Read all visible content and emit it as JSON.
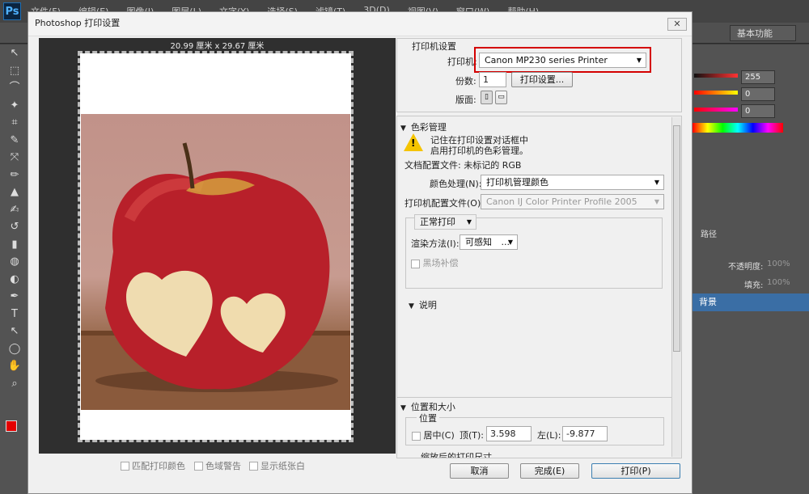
{
  "ps": {
    "logo": "Ps",
    "menu": [
      "文件(F)",
      "编辑(E)",
      "图像(I)",
      "图层(L)",
      "文字(Y)",
      "选择(S)",
      "滤镜(T)",
      "3D(D)",
      "视图(V)",
      "窗口(W)",
      "帮助(H)"
    ],
    "workspace": "基本功能",
    "color_values": [
      "255",
      "0",
      "0"
    ],
    "panel_tab": "路径",
    "opacity_label": "不透明度:",
    "opacity_value": "100%",
    "fill_label": "填充:",
    "fill_value": "100%",
    "layer_name": "背景",
    "tools": [
      "↖",
      "⬚",
      "⌒",
      "✦",
      "⌗",
      "✎",
      "⤧",
      "✏",
      "▲",
      "✍",
      "↺",
      "▮",
      "◍",
      "◐",
      "✒",
      "T",
      "↖",
      "◯",
      "✋",
      "⌕"
    ]
  },
  "dialog": {
    "title": "Photoshop 打印设置",
    "close": "✕",
    "preview_size": "20.99 厘米 x 29.67 厘米",
    "checkboxes": [
      "匹配打印颜色",
      "色域警告",
      "显示纸张白"
    ],
    "printer_settings": {
      "header": "打印机设置",
      "printer_label": "打印机:",
      "printer_value": "Canon MP230 series Printer",
      "copies_label": "份数:",
      "copies_value": "1",
      "print_settings_button": "打印设置...",
      "layout_label": "版面:"
    },
    "color_management": {
      "header": "色彩管理",
      "warning_line1": "记住在打印设置对话框中",
      "warning_line2": "启用打印机的色彩管理。",
      "doc_profile": "文档配置文件: 未标记的 RGB",
      "color_handling_label": "颜色处理(N):",
      "color_handling_value": "打印机管理颜色",
      "printer_profile_label": "打印机配置文件(O):",
      "printer_profile_value": "Canon IJ Color Printer Profile 2005",
      "mode_value": "正常打印",
      "rendering_label": "渲染方法(I):",
      "rendering_value": "可感知",
      "rendering_more": "...",
      "black_point": "黑场补偿"
    },
    "description_header": "说明",
    "position_size": {
      "header": "位置和大小",
      "position_label": "位置",
      "center_label": "居中(C)",
      "top_label": "顶(T):",
      "top_value": "3.598",
      "left_label": "左(L):",
      "left_value": "-9.877",
      "scaled_label": "缩放后的打印尺寸"
    },
    "buttons": {
      "cancel": "取消",
      "done": "完成(E)",
      "print": "打印(P)"
    }
  }
}
